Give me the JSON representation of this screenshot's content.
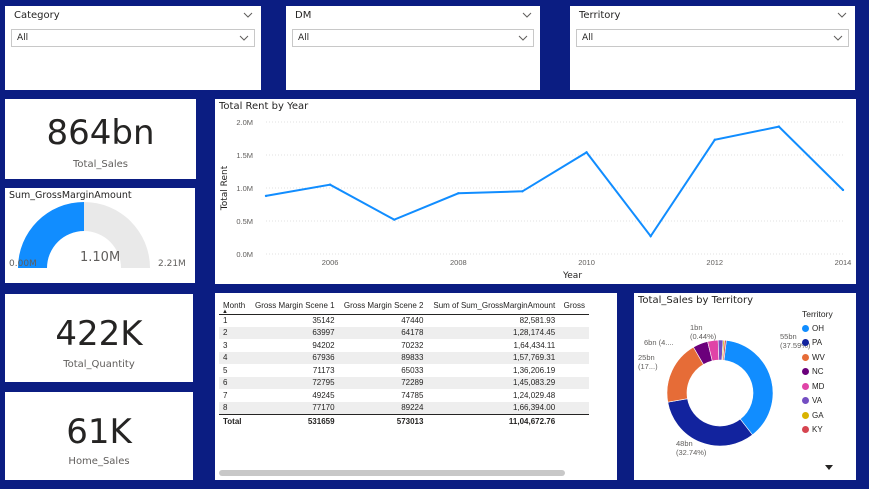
{
  "slicers": [
    {
      "title": "Category",
      "value": "All"
    },
    {
      "title": "DM",
      "value": "All"
    },
    {
      "title": "Territory",
      "value": "All"
    }
  ],
  "kpis": {
    "total_sales": {
      "value": "864bn",
      "label": "Total_Sales"
    },
    "total_quantity": {
      "value": "422K",
      "label": "Total_Quantity"
    },
    "home_sales": {
      "value": "61K",
      "label": "Home_Sales"
    }
  },
  "gauge": {
    "title": "Sum_GrossMarginAmount",
    "value_label": "1.10M",
    "min_label": "0.00M",
    "max_label": "2.21M",
    "fraction": 0.5,
    "color": "#118dff"
  },
  "line_chart": {
    "title": "Total Rent by Year",
    "chart_data": {
      "type": "line",
      "title": "Total Rent by Year",
      "xlabel": "Year",
      "ylabel": "Total Rent",
      "x": [
        2005,
        2006,
        2007,
        2008,
        2009,
        2010,
        2011,
        2012,
        2013,
        2014
      ],
      "values": [
        0.88,
        1.05,
        0.52,
        0.92,
        0.95,
        1.54,
        0.27,
        1.73,
        1.93,
        0.97
      ],
      "xticks": [
        "2006",
        "2008",
        "2010",
        "2012",
        "2014"
      ],
      "yticks": [
        "0.0M",
        "0.5M",
        "1.0M",
        "1.5M",
        "2.0M"
      ],
      "xlim": [
        2005,
        2014
      ],
      "ylim": [
        0,
        2.0
      ],
      "grid": true,
      "color": "#118dff"
    }
  },
  "table": {
    "columns": [
      "Month",
      "Gross Margin Scene 1",
      "Gross Margin Scene 2",
      "Sum of Sum_GrossMarginAmount",
      "Gross"
    ],
    "rows": [
      [
        "1",
        "35142",
        "47440",
        "82,581.93"
      ],
      [
        "2",
        "63997",
        "64178",
        "1,28,174.45"
      ],
      [
        "3",
        "94202",
        "70232",
        "1,64,434.11"
      ],
      [
        "4",
        "67936",
        "89833",
        "1,57,769.31"
      ],
      [
        "5",
        "71173",
        "65033",
        "1,36,206.19"
      ],
      [
        "6",
        "72795",
        "72289",
        "1,45,083.29"
      ],
      [
        "7",
        "49245",
        "74785",
        "1,24,029.48"
      ],
      [
        "8",
        "77170",
        "89224",
        "1,66,394.00"
      ]
    ],
    "total": [
      "Total",
      "531659",
      "573013",
      "11,04,672.76"
    ],
    "sort_indicator": "▲"
  },
  "donut": {
    "title": "Total_Sales by Territory",
    "legend_title": "Territory",
    "chart_data": {
      "type": "pie",
      "title": "Total_Sales by Territory",
      "categories": [
        "OH",
        "PA",
        "WV",
        "NC",
        "MD",
        "VA",
        "GA",
        "KY"
      ],
      "values": [
        37.59,
        32.74,
        19.4,
        4.6,
        3.2,
        1.5,
        0.44,
        0.53
      ],
      "colors": [
        "#118dff",
        "#12239e",
        "#e66c37",
        "#6b007b",
        "#e044a7",
        "#744ec2",
        "#d9b300",
        "#d64550"
      ],
      "data_labels": [
        {
          "line1": "55bn",
          "line2": "(37.59%)"
        },
        {
          "line1": "48bn",
          "line2": "(32.74%)"
        },
        {
          "line1": "25bn",
          "line2": "(17...)"
        },
        {
          "line1": "6bn (4....",
          "line2": ""
        },
        {
          "line1": "1bn",
          "line2": "(0.44%)"
        }
      ]
    }
  }
}
